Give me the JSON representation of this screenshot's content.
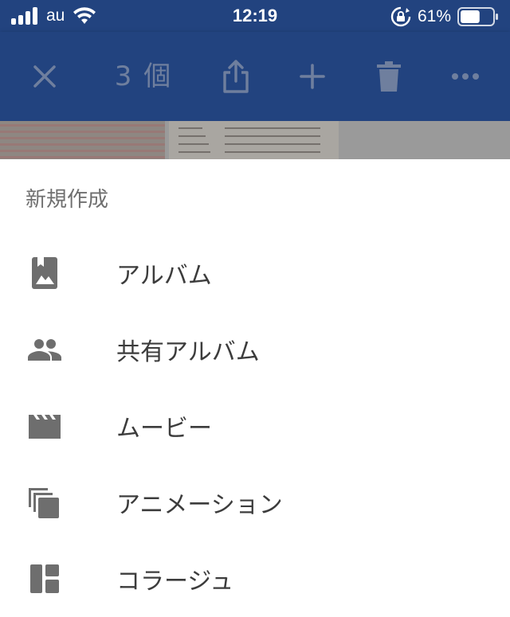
{
  "status_bar": {
    "carrier": "au",
    "time": "12:19",
    "battery_percent": "61%",
    "battery_level": 0.61,
    "icons": [
      "signal-bars-icon",
      "wifi-icon",
      "rotation-lock-icon",
      "battery-icon"
    ]
  },
  "app_bar": {
    "selection_count": "3 個",
    "icons": [
      "close-icon",
      "share-icon",
      "add-icon",
      "trash-icon",
      "more-icon"
    ]
  },
  "sheet": {
    "title": "新規作成",
    "items": [
      {
        "label": "アルバム",
        "icon": "album-icon"
      },
      {
        "label": "共有アルバム",
        "icon": "people-icon"
      },
      {
        "label": "ムービー",
        "icon": "movie-icon"
      },
      {
        "label": "アニメーション",
        "icon": "animation-icon"
      },
      {
        "label": "コラージュ",
        "icon": "collage-icon"
      }
    ]
  },
  "colors": {
    "app_bar": "#22437f",
    "disabled_action": "#6f7f9e",
    "icon_grey": "#6e6e6e",
    "text": "#3c3c3c",
    "subtitle": "#6f6f6f"
  }
}
